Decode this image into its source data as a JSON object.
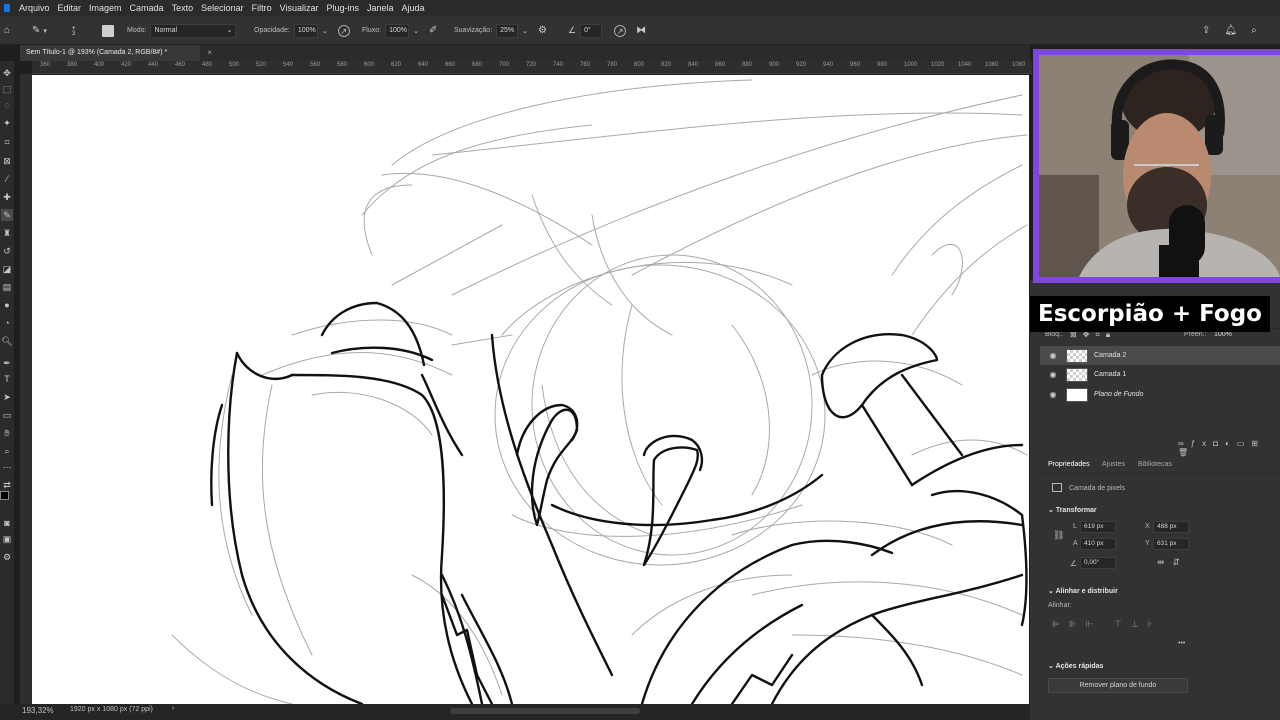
{
  "menu": [
    "Arquivo",
    "Editar",
    "Imagem",
    "Camada",
    "Texto",
    "Selecionar",
    "Filtro",
    "Visualizar",
    "Plug-ins",
    "Janela",
    "Ajuda"
  ],
  "options": {
    "brush_size": "3",
    "mode_label": "Modo:",
    "mode_value": "Normal",
    "opacity_label": "Opacidade:",
    "opacity_value": "100%",
    "flow_label": "Fluxo:",
    "flow_value": "100%",
    "smoothing_label": "Suavização:",
    "smoothing_value": "25%",
    "angle_value": "0°"
  },
  "document_tab": {
    "title": "Sem Título-1 @ 193% (Camada 2, RGB/8#) *",
    "close": "×"
  },
  "ruler_ticks": [
    "360",
    "380",
    "400",
    "420",
    "440",
    "460",
    "480",
    "500",
    "520",
    "540",
    "560",
    "580",
    "600",
    "620",
    "640",
    "660",
    "680",
    "700",
    "720",
    "740",
    "760",
    "780",
    "800",
    "820",
    "840",
    "860",
    "880",
    "900",
    "920",
    "940",
    "960",
    "980",
    "1000",
    "1020",
    "1040",
    "1060",
    "1080",
    "1100"
  ],
  "status": {
    "zoom": "193,32%",
    "doc_size": "1920 px x 1080 px (72 ppi)",
    "arrow": "›"
  },
  "caption": "Escorpião + Fogo",
  "layers_header": {
    "lock_label": "Bloq.:",
    "fill_label": "Preen.:",
    "fill_value": "100%"
  },
  "layers": [
    {
      "name": "Camada 2",
      "selected": true,
      "italic": false
    },
    {
      "name": "Camada 1",
      "selected": false,
      "italic": false
    },
    {
      "name": "Plano de Fundo",
      "selected": false,
      "italic": true
    }
  ],
  "properties": {
    "tabs": [
      "Propriedades",
      "Ajustes",
      "Bibliotecas"
    ],
    "layer_type": "Camada de pixels",
    "transform_title": "Transformar",
    "w_label": "L",
    "w_value": "619 px",
    "h_label": "A",
    "h_value": "410 px",
    "x_label": "X",
    "x_value": "488 px",
    "y_label": "Y",
    "y_value": "631 px",
    "angle_value": "0,00°",
    "align_title": "Alinhar e distribuir",
    "align_label": "Alinhar:",
    "more": "•••",
    "quick_actions_title": "Ações rápidas",
    "remove_bg_button": "Remover plano de fundo"
  },
  "colors": {
    "accent": "#7e47dd",
    "panel": "#323232",
    "canvas": "#ffffff",
    "app_bg": "#1e1e1e"
  }
}
